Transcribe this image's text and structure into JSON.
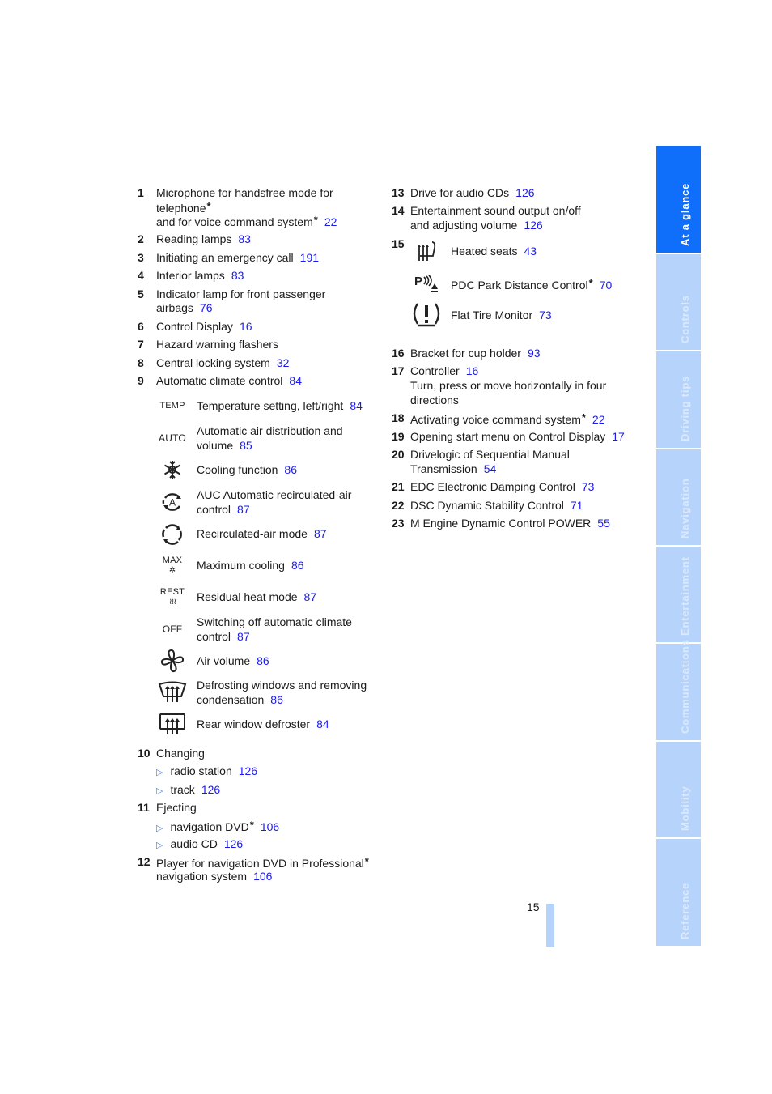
{
  "left_items": [
    {
      "num": "1",
      "lines": [
        "Microphone for handsfree mode for",
        "telephone*",
        "and for voice command system*"
      ],
      "page": "22"
    },
    {
      "num": "2",
      "lines": [
        "Reading lamps"
      ],
      "page": "83"
    },
    {
      "num": "3",
      "lines": [
        "Initiating an emergency call"
      ],
      "page": "191"
    },
    {
      "num": "4",
      "lines": [
        "Interior lamps"
      ],
      "page": "83"
    },
    {
      "num": "5",
      "lines": [
        "Indicator lamp for front passenger",
        "airbags"
      ],
      "page": "76"
    },
    {
      "num": "6",
      "lines": [
        "Control Display"
      ],
      "page": "16"
    },
    {
      "num": "7",
      "lines": [
        "Hazard warning flashers"
      ],
      "page": ""
    },
    {
      "num": "8",
      "lines": [
        "Central locking system"
      ],
      "page": "32"
    },
    {
      "num": "9",
      "lines": [
        "Automatic climate control"
      ],
      "page": "84"
    }
  ],
  "climate_controls": [
    {
      "icon": "temp-icon",
      "icon_text": "TEMP",
      "lines": [
        "Temperature setting, left/right"
      ],
      "page": "84"
    },
    {
      "icon": "auto-icon",
      "icon_text": "AUTO",
      "lines": [
        "Automatic air distribution and",
        "volume"
      ],
      "page": "85"
    },
    {
      "icon": "snowflake-icon",
      "icon_text": "❄",
      "lines": [
        "Cooling function"
      ],
      "page": "86"
    },
    {
      "icon": "auc-recirculation-icon",
      "icon_text": "A",
      "lines": [
        "AUC Automatic recirculated-air",
        "control"
      ],
      "page": "87"
    },
    {
      "icon": "recirculation-icon",
      "icon_text": "",
      "lines": [
        "Recirculated-air mode"
      ],
      "page": "87"
    },
    {
      "icon": "max-cooling-icon",
      "icon_text": "MAX",
      "lines": [
        "Maximum cooling"
      ],
      "page": "86"
    },
    {
      "icon": "residual-heat-icon",
      "icon_text": "REST",
      "lines": [
        "Residual heat mode"
      ],
      "page": "87"
    },
    {
      "icon": "off-icon",
      "icon_text": "OFF",
      "lines": [
        "Switching off automatic climate",
        "control"
      ],
      "page": "87"
    },
    {
      "icon": "fan-icon",
      "icon_text": "",
      "lines": [
        "Air volume"
      ],
      "page": "86"
    },
    {
      "icon": "windshield-defrost-icon",
      "icon_text": "",
      "lines": [
        "Defrosting windows and removing",
        "condensation"
      ],
      "page": "86"
    },
    {
      "icon": "rear-window-defrost-icon",
      "icon_text": "",
      "lines": [
        "Rear window defroster"
      ],
      "page": "84"
    }
  ],
  "item10": {
    "num": "10",
    "label": "Changing",
    "subs": [
      {
        "label": "radio station",
        "page": "126"
      },
      {
        "label": "track",
        "page": "126"
      }
    ]
  },
  "item11": {
    "num": "11",
    "label": "Ejecting",
    "subs": [
      {
        "label": "navigation DVD*",
        "page": "106"
      },
      {
        "label": "audio CD",
        "page": "126"
      }
    ]
  },
  "item12": {
    "num": "12",
    "lines": [
      "Player for navigation DVD in Professional*",
      "navigation system"
    ],
    "page": "106"
  },
  "right_items_top": [
    {
      "num": "13",
      "lines": [
        "Drive for audio CDs"
      ],
      "page": "126"
    },
    {
      "num": "14",
      "lines": [
        "Entertainment sound output on/off",
        "and adjusting volume"
      ],
      "page": "126"
    }
  ],
  "item15": {
    "num": "15",
    "entries": [
      {
        "icon": "heated-seat-icon",
        "label": "Heated seats",
        "page": "43"
      },
      {
        "icon": "park-distance-control-icon",
        "label": "PDC Park Distance Control*",
        "page": "70"
      },
      {
        "icon": "flat-tire-monitor-icon",
        "label": "Flat Tire Monitor",
        "page": "73"
      }
    ]
  },
  "right_items_bottom": [
    {
      "num": "16",
      "lines": [
        "Bracket for cup holder"
      ],
      "page": "93"
    },
    {
      "num": "17",
      "lines": [
        "Controller"
      ],
      "page": "16",
      "extra": [
        "Turn, press or move horizontally in four",
        "directions"
      ]
    },
    {
      "num": "18",
      "lines": [
        "Activating voice command system*"
      ],
      "page": "22"
    },
    {
      "num": "19",
      "lines": [
        "Opening start menu on Control Display"
      ],
      "page": "17"
    },
    {
      "num": "20",
      "lines": [
        "Drivelogic of Sequential Manual",
        "Transmission"
      ],
      "page": "54"
    },
    {
      "num": "21",
      "lines": [
        "EDC Electronic Damping Control"
      ],
      "page": "73"
    },
    {
      "num": "22",
      "lines": [
        "DSC Dynamic Stability Control"
      ],
      "page": "71"
    },
    {
      "num": "23",
      "lines": [
        "M Engine Dynamic Control POWER"
      ],
      "page": "55"
    }
  ],
  "side_tabs": [
    {
      "label": "At a glance",
      "active": true
    },
    {
      "label": "Controls",
      "active": false
    },
    {
      "label": "Driving tips",
      "active": false
    },
    {
      "label": "Navigation",
      "active": false
    },
    {
      "label": "Entertainment",
      "active": false
    },
    {
      "label": "Communications",
      "active": false
    },
    {
      "label": "Mobility",
      "active": false
    },
    {
      "label": "Reference",
      "active": false
    }
  ],
  "page_number": "15",
  "colors": {
    "link": "#1a1aee",
    "tab_active": "#0f6ffb",
    "tab_inactive": "#b6d4fb"
  }
}
